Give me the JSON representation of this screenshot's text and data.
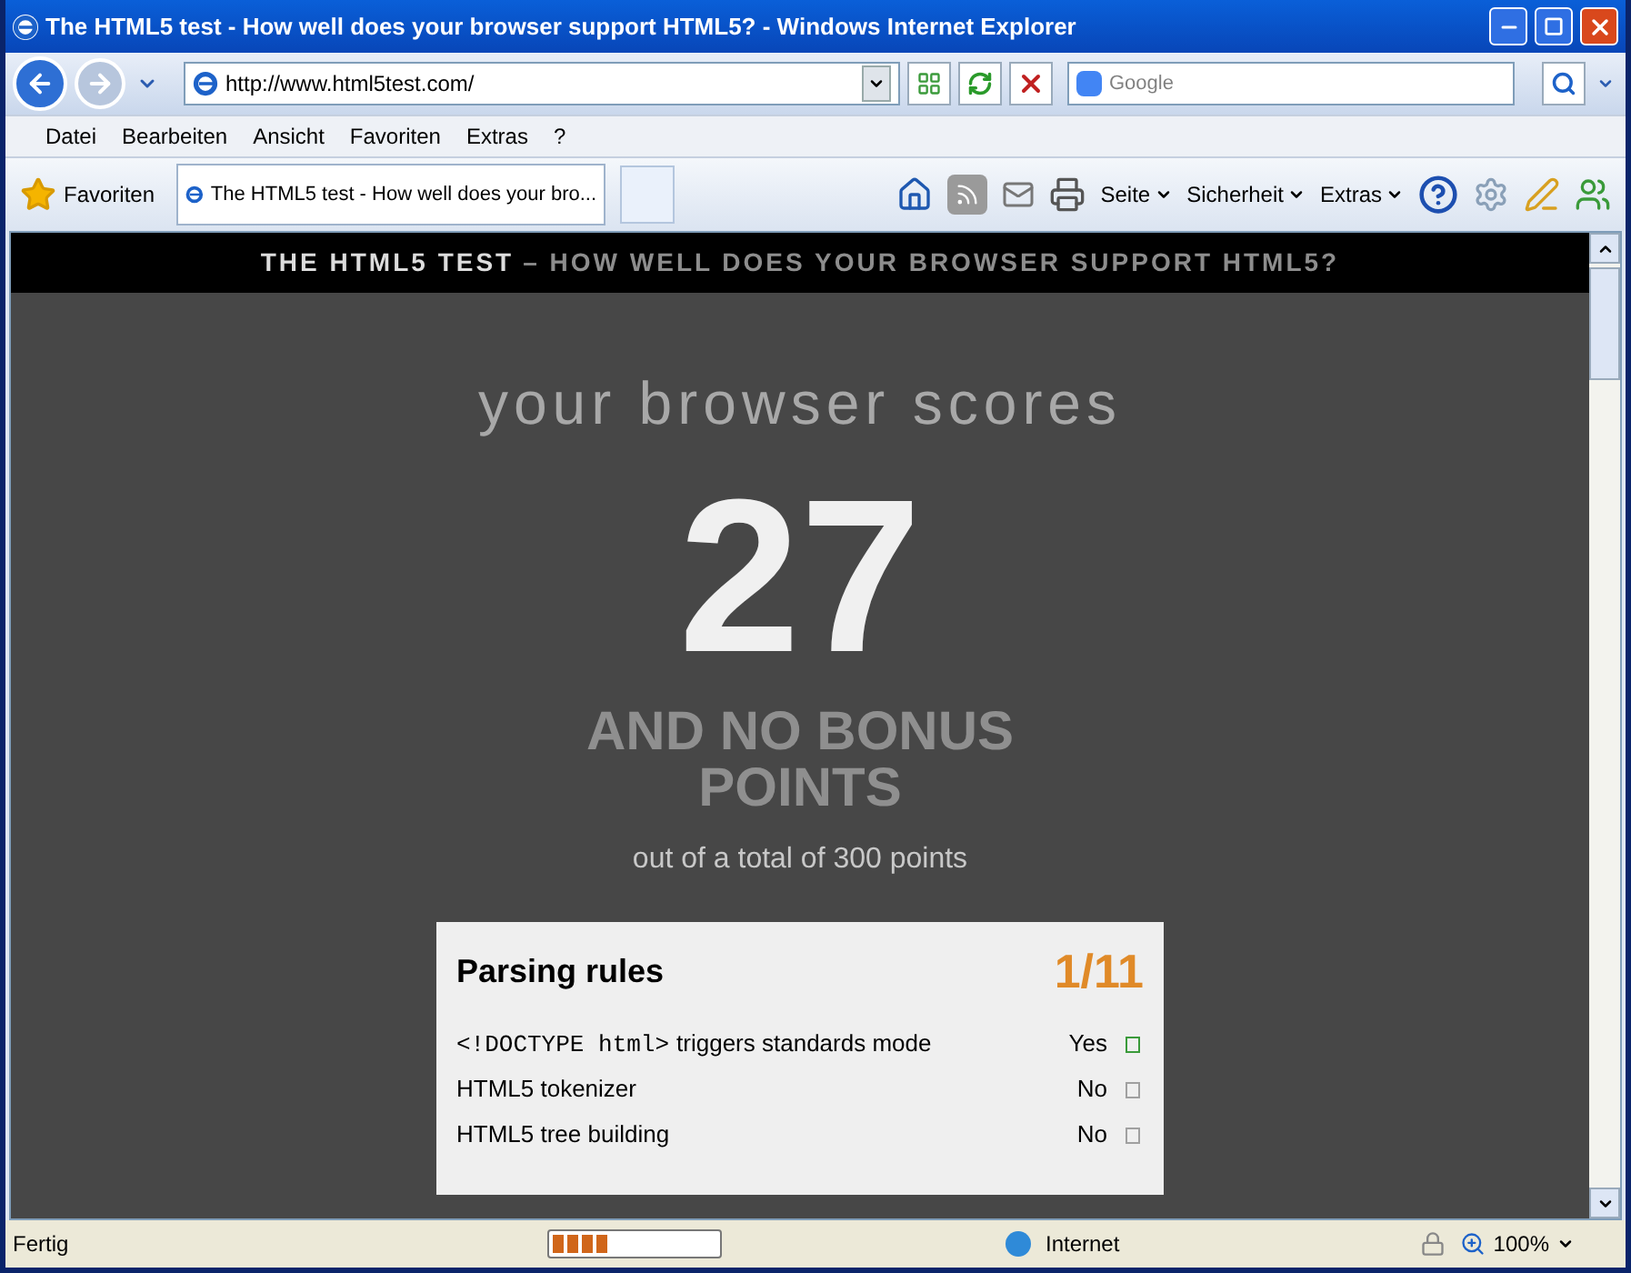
{
  "window": {
    "title": "The HTML5 test - How well does your browser support HTML5? - Windows Internet Explorer"
  },
  "address_bar": {
    "url": "http://www.html5test.com/"
  },
  "search": {
    "placeholder": "Google"
  },
  "menu": [
    "Datei",
    "Bearbeiten",
    "Ansicht",
    "Favoriten",
    "Extras",
    "?"
  ],
  "favorites_bar": {
    "favorites": "Favoriten",
    "tab": "The HTML5 test - How well does your bro...",
    "commands": [
      "Seite",
      "Sicherheit",
      "Extras"
    ]
  },
  "page": {
    "header_title": "THE HTML5 TEST",
    "header_subtitle": "– HOW WELL DOES YOUR BROWSER SUPPORT HTML5?",
    "intro": "your browser scores",
    "score": "27",
    "bonus": "AND NO BONUS POINTS",
    "total": "out of a total of 300 points",
    "section": {
      "title": "Parsing rules",
      "score": "1/11",
      "rows": [
        {
          "code": "<!DOCTYPE html>",
          "label": "triggers standards mode",
          "result": "Yes",
          "passed": true
        },
        {
          "label": "HTML5 tokenizer",
          "result": "No",
          "passed": false
        },
        {
          "label": "HTML5 tree building",
          "result": "No",
          "passed": false
        }
      ]
    }
  },
  "status_bar": {
    "status": "Fertig",
    "progress": {
      "level": 0.35
    },
    "zone": "Internet",
    "zoom": "100%"
  }
}
